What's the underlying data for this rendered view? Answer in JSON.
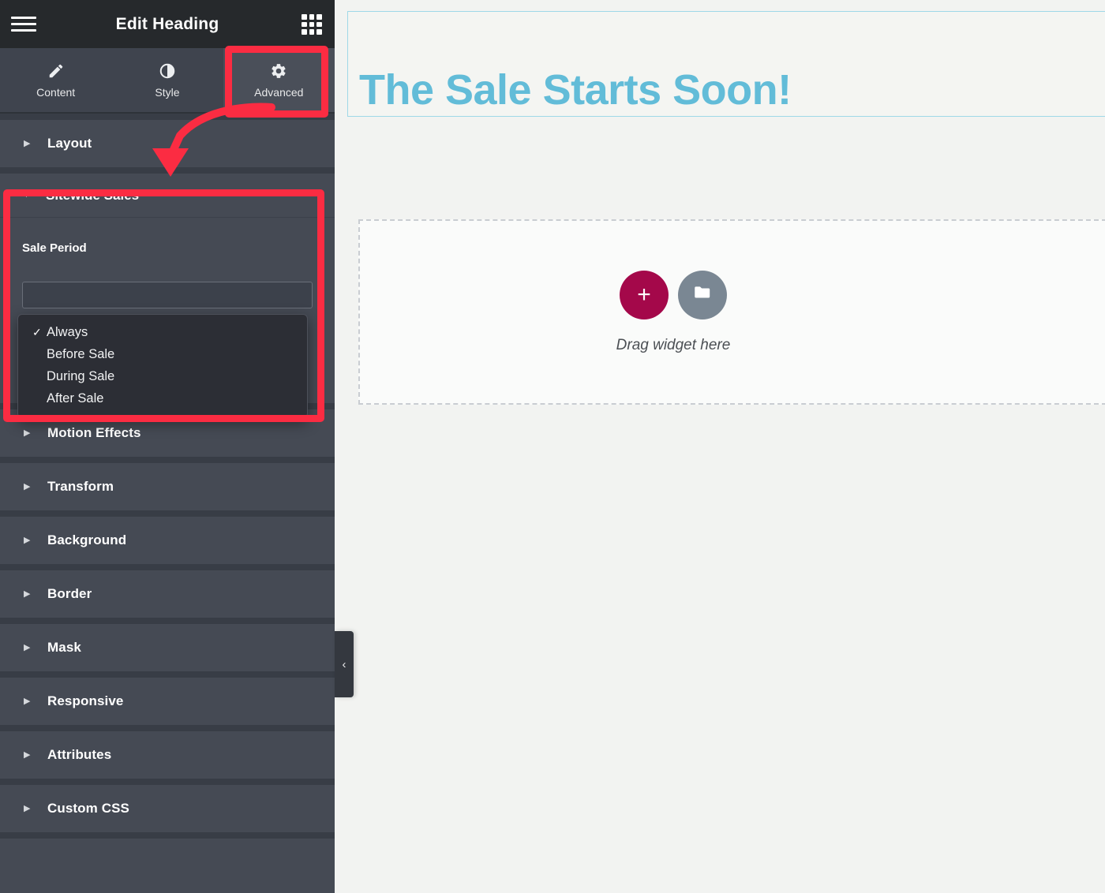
{
  "panel": {
    "title": "Edit Heading",
    "menu_icon": "hamburger-menu-icon",
    "grid_icon": "widgets-grid-icon",
    "tabs": [
      {
        "label": "Content",
        "icon": "pencil-icon",
        "active": false
      },
      {
        "label": "Style",
        "icon": "contrast-circle-icon",
        "active": false
      },
      {
        "label": "Advanced",
        "icon": "gear-icon",
        "active": true
      }
    ],
    "sections": [
      {
        "label": "Layout",
        "expanded": false,
        "caret": "▶"
      },
      {
        "label": "Motion Effects",
        "expanded": false,
        "caret": "▶"
      },
      {
        "label": "Transform",
        "expanded": false,
        "caret": "▶"
      },
      {
        "label": "Background",
        "expanded": false,
        "caret": "▶"
      },
      {
        "label": "Border",
        "expanded": false,
        "caret": "▶"
      },
      {
        "label": "Mask",
        "expanded": false,
        "caret": "▶"
      },
      {
        "label": "Responsive",
        "expanded": false,
        "caret": "▶"
      },
      {
        "label": "Attributes",
        "expanded": false,
        "caret": "▶"
      },
      {
        "label": "Custom CSS",
        "expanded": false,
        "caret": "▶"
      }
    ],
    "sitewide_sales": {
      "label": "Sitewide Sales",
      "caret": "▼",
      "expanded": true,
      "field_label": "Sale Period",
      "selected_value": "Always",
      "options": [
        {
          "label": "Always",
          "selected": true
        },
        {
          "label": "Before Sale",
          "selected": false
        },
        {
          "label": "During Sale",
          "selected": false
        },
        {
          "label": "After Sale",
          "selected": false
        }
      ],
      "check_glyph": "✓"
    },
    "collapse_handle": {
      "icon": "chevron-left-icon",
      "glyph": "‹"
    }
  },
  "canvas": {
    "heading": "The Sale Starts Soon!",
    "heading_color": "#62bcd8",
    "dropzone": {
      "caption": "Drag widget here",
      "add_button": {
        "icon": "plus-icon",
        "glyph": "+",
        "color": "#a4084a"
      },
      "folder_button": {
        "icon": "folder-icon",
        "color": "#7a8793"
      }
    }
  },
  "annotations": {
    "color": "#fb2c42",
    "advanced_tab_highlight": "Advanced",
    "sitewide_sales_highlight": "Sitewide Sales",
    "arrow": "curved-arrow-icon"
  }
}
